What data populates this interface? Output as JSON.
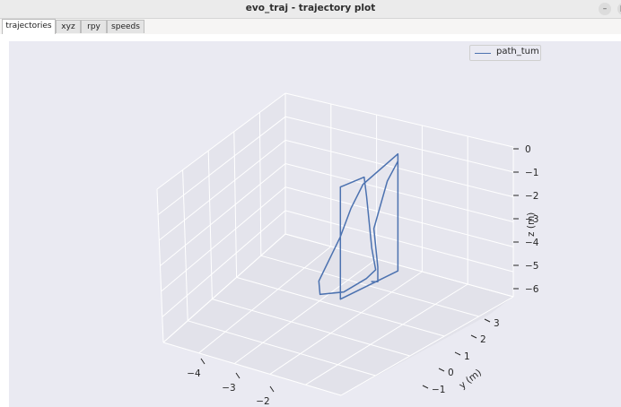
{
  "window": {
    "title": "evo_traj - trajectory plot",
    "minimize_glyph": "–",
    "maximize_glyph": "□"
  },
  "tabs": [
    {
      "label": "trajectories",
      "active": true
    },
    {
      "label": "xyz",
      "active": false
    },
    {
      "label": "rpy",
      "active": false
    },
    {
      "label": "speeds",
      "active": false
    }
  ],
  "legend": {
    "label": "path_tum",
    "color": "#4c72b0"
  },
  "colors": {
    "pane_bg": "#eaeaf2",
    "grid": "#ffffff",
    "series": "#4c72b0",
    "text": "#262626"
  },
  "chart_data": {
    "type": "line",
    "projection": "3d",
    "title": "",
    "xlabel": "",
    "ylabel": "y (m)",
    "zlabel": "z (m)",
    "x_ticks": [
      "−4",
      "−3",
      "−2"
    ],
    "y_ticks": [
      "3",
      "2",
      "1",
      "0",
      "−1"
    ],
    "z_ticks": [
      "0",
      "−1",
      "−2",
      "−3",
      "−4",
      "−5",
      "−6"
    ],
    "grid": true,
    "legend_position": "top-right",
    "series": [
      {
        "name": "path_tum",
        "points_xyz": [
          [
            -1.2,
            1.0,
            -0.6
          ],
          [
            -1.2,
            1.0,
            -5.4
          ],
          [
            -1.5,
            -0.7,
            -5.3
          ],
          [
            -1.5,
            -0.7,
            -0.7
          ],
          [
            -1.1,
            -0.4,
            -0.6
          ],
          [
            -0.9,
            -0.6,
            -1.3
          ],
          [
            -0.7,
            -0.7,
            -3.4
          ],
          [
            -0.6,
            -0.7,
            -4.3
          ],
          [
            -0.7,
            -0.9,
            -4.5
          ],
          [
            -1.0,
            -1.3,
            -4.7
          ],
          [
            -1.4,
            -1.6,
            -4.5
          ],
          [
            -1.5,
            -1.5,
            -4.0
          ],
          [
            -1.3,
            -1.0,
            -2.6
          ],
          [
            -1.3,
            -0.6,
            -1.7
          ],
          [
            -1.4,
            0.0,
            -1.1
          ],
          [
            -1.2,
            1.0,
            -0.6
          ],
          [
            -1.2,
            1.0,
            -0.9
          ],
          [
            -1.4,
            0.9,
            -1.6
          ],
          [
            -1.4,
            0.4,
            -3.2
          ],
          [
            -1.3,
            0.4,
            -4.8
          ],
          [
            -1.3,
            0.4,
            -5.4
          ],
          [
            -1.4,
            0.3,
            -5.3
          ]
        ]
      }
    ]
  }
}
